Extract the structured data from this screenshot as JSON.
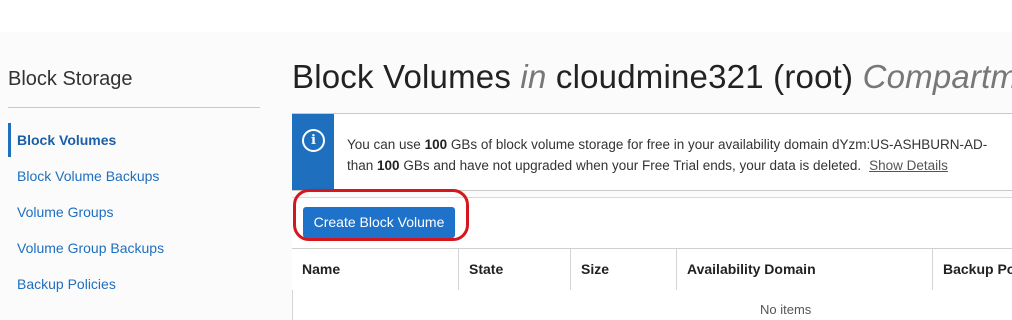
{
  "sidebar": {
    "title": "Block Storage",
    "items": [
      {
        "label": "Block Volumes",
        "active": true
      },
      {
        "label": "Block Volume Backups"
      },
      {
        "label": "Volume Groups"
      },
      {
        "label": "Volume Group Backups"
      },
      {
        "label": "Backup Policies"
      }
    ]
  },
  "main": {
    "title_prefix": "Block Volumes",
    "title_in": "in",
    "title_compartment": "cloudmine321 (root)",
    "title_suffix": "Compartm",
    "banner": {
      "line1_pre": "You can use ",
      "line1_bold": "100",
      "line1_post": " GBs of block volume storage for free in your availability domain dYzm:US-ASHBURN-AD-",
      "line2_pre": "than ",
      "line2_bold": "100",
      "line2_post": " GBs and have not upgraded when your Free Trial ends, your data is deleted.",
      "link": "Show Details"
    },
    "create_button": "Create Block Volume",
    "table": {
      "columns": [
        "Name",
        "State",
        "Size",
        "Availability Domain",
        "Backup Po"
      ],
      "empty_text": "No items"
    }
  },
  "colors": {
    "accent": "#1f6fbf",
    "highlight": "#d6161e"
  }
}
